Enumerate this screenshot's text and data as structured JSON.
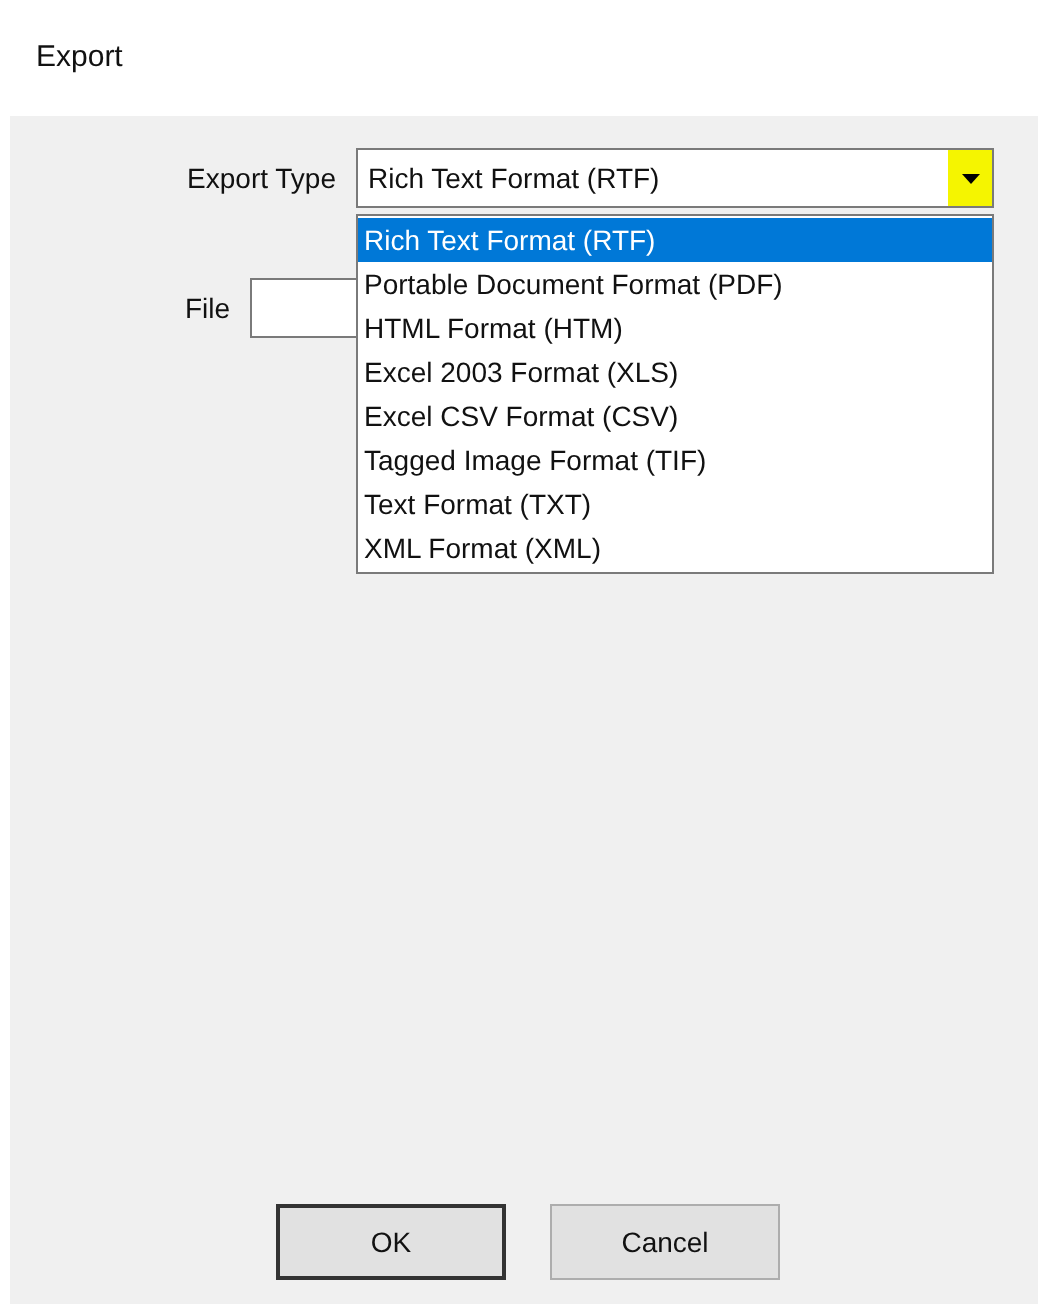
{
  "window": {
    "title": "Export"
  },
  "export_type": {
    "label": "Export Type",
    "value": "Rich Text Format (RTF)",
    "expanded": true,
    "options": [
      {
        "label": "Rich Text Format (RTF)",
        "selected": true
      },
      {
        "label": "Portable Document Format (PDF)",
        "selected": false
      },
      {
        "label": "HTML Format (HTM)",
        "selected": false
      },
      {
        "label": "Excel 2003 Format (XLS)",
        "selected": false
      },
      {
        "label": "Excel CSV Format (CSV)",
        "selected": false
      },
      {
        "label": "Tagged Image Format (TIF)",
        "selected": false
      },
      {
        "label": "Text Format (TXT)",
        "selected": false
      },
      {
        "label": "XML Format (XML)",
        "selected": false
      }
    ]
  },
  "file": {
    "label": "File"
  },
  "buttons": [
    {
      "label": "OK",
      "default": true
    },
    {
      "label": "Cancel",
      "default": false
    }
  ]
}
